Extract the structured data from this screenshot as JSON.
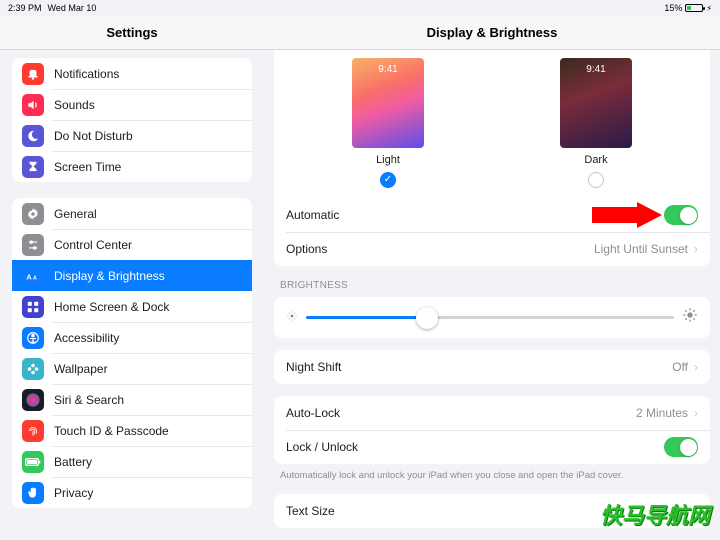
{
  "statusbar": {
    "time": "2:39 PM",
    "date": "Wed Mar 10",
    "battery_pct": "15%"
  },
  "header": {
    "left_title": "Settings",
    "right_title": "Display & Brightness"
  },
  "sidebar": {
    "groups": [
      {
        "items": [
          {
            "name": "sidebar-item-notifications",
            "label": "Notifications",
            "icon_bg": "#ff3b30",
            "svg": "bell"
          },
          {
            "name": "sidebar-item-sounds",
            "label": "Sounds",
            "icon_bg": "#ff2d55",
            "svg": "speaker"
          },
          {
            "name": "sidebar-item-do-not-disturb",
            "label": "Do Not Disturb",
            "icon_bg": "#5856d6",
            "svg": "moon"
          },
          {
            "name": "sidebar-item-screen-time",
            "label": "Screen Time",
            "icon_bg": "#5856d6",
            "svg": "hourglass"
          }
        ]
      },
      {
        "items": [
          {
            "name": "sidebar-item-general",
            "label": "General",
            "icon_bg": "#8e8e93",
            "svg": "gear"
          },
          {
            "name": "sidebar-item-control-center",
            "label": "Control Center",
            "icon_bg": "#8e8e93",
            "svg": "sliders"
          },
          {
            "name": "sidebar-item-display-brightness",
            "label": "Display & Brightness",
            "icon_bg": "#0a7cff",
            "svg": "aa",
            "selected": true
          },
          {
            "name": "sidebar-item-home-screen-dock",
            "label": "Home Screen & Dock",
            "icon_bg": "#4242d0",
            "svg": "grid"
          },
          {
            "name": "sidebar-item-accessibility",
            "label": "Accessibility",
            "icon_bg": "#0a7cff",
            "svg": "figure"
          },
          {
            "name": "sidebar-item-wallpaper",
            "label": "Wallpaper",
            "icon_bg": "#38b5c9",
            "svg": "flower"
          },
          {
            "name": "sidebar-item-siri-search",
            "label": "Siri & Search",
            "icon_bg": "#1c1c1e",
            "svg": "siri"
          },
          {
            "name": "sidebar-item-touch-id-passcode",
            "label": "Touch ID & Passcode",
            "icon_bg": "#ff3b30",
            "svg": "fingerprint"
          },
          {
            "name": "sidebar-item-battery",
            "label": "Battery",
            "icon_bg": "#34c759",
            "svg": "battery"
          },
          {
            "name": "sidebar-item-privacy",
            "label": "Privacy",
            "icon_bg": "#0a7cff",
            "svg": "hand"
          }
        ]
      }
    ]
  },
  "appearance": {
    "light_label": "Light",
    "dark_label": "Dark",
    "light_time": "9:41",
    "dark_time": "9:41",
    "selected": "light"
  },
  "rows": {
    "automatic_label": "Automatic",
    "automatic_on": true,
    "options_label": "Options",
    "options_value": "Light Until Sunset",
    "brightness_header": "BRIGHTNESS",
    "brightness_pct": 33,
    "night_shift_label": "Night Shift",
    "night_shift_value": "Off",
    "auto_lock_label": "Auto-Lock",
    "auto_lock_value": "2 Minutes",
    "lock_unlock_label": "Lock / Unlock",
    "lock_unlock_on": true,
    "lock_unlock_foot": "Automatically lock and unlock your iPad when you close and open the iPad cover.",
    "text_size_label": "Text Size"
  },
  "watermark": "快马导航网"
}
